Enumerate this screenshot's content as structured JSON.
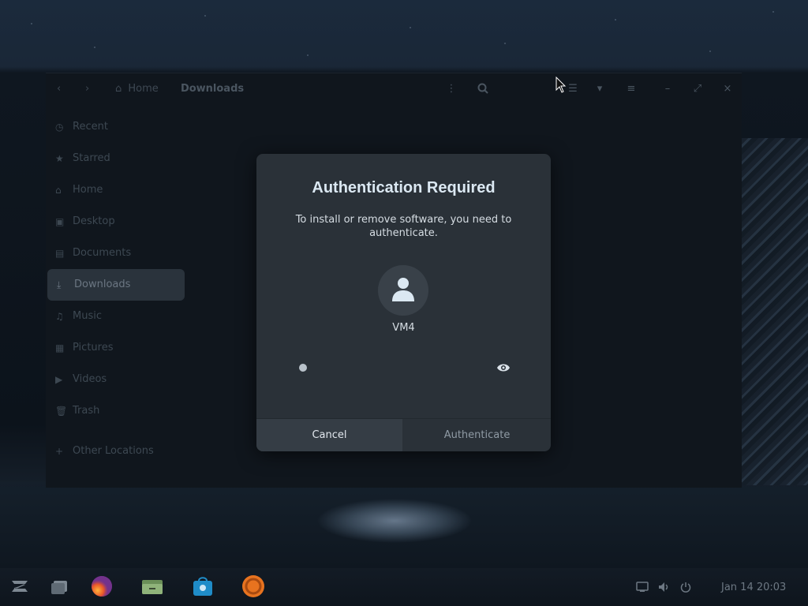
{
  "file_manager": {
    "breadcrumb": {
      "home": "Home",
      "current": "Downloads"
    },
    "header_icons": [
      "back-icon",
      "forward-icon",
      "more-icon",
      "search-icon",
      "view-list-icon",
      "dropdown-icon",
      "menu-icon",
      "minimize-icon",
      "maximize-icon",
      "close-icon"
    ],
    "sidebar": {
      "items": [
        {
          "label": "Recent",
          "icon": "clock-icon"
        },
        {
          "label": "Starred",
          "icon": "star-icon"
        },
        {
          "label": "Home",
          "icon": "home-icon"
        },
        {
          "label": "Desktop",
          "icon": "desktop-icon"
        },
        {
          "label": "Documents",
          "icon": "document-icon"
        },
        {
          "label": "Downloads",
          "icon": "download-icon",
          "active": true
        },
        {
          "label": "Music",
          "icon": "music-icon"
        },
        {
          "label": "Pictures",
          "icon": "picture-icon"
        },
        {
          "label": "Videos",
          "icon": "video-icon"
        },
        {
          "label": "Trash",
          "icon": "trash-icon"
        }
      ],
      "other_locations": "Other Locations"
    }
  },
  "dialog": {
    "title": "Authentication Required",
    "message": "To install or remove software, you need to authenticate.",
    "username": "VM4",
    "buttons": {
      "cancel": "Cancel",
      "authenticate": "Authenticate"
    }
  },
  "taskbar": {
    "apps": [
      "zorin-menu-icon",
      "workspace-switcher-icon",
      "firefox-icon",
      "files-icon",
      "software-store-icon",
      "settings-icon"
    ],
    "tray": [
      "network-icon",
      "volume-icon",
      "power-icon"
    ],
    "clock": "Jan 14  20:03"
  }
}
